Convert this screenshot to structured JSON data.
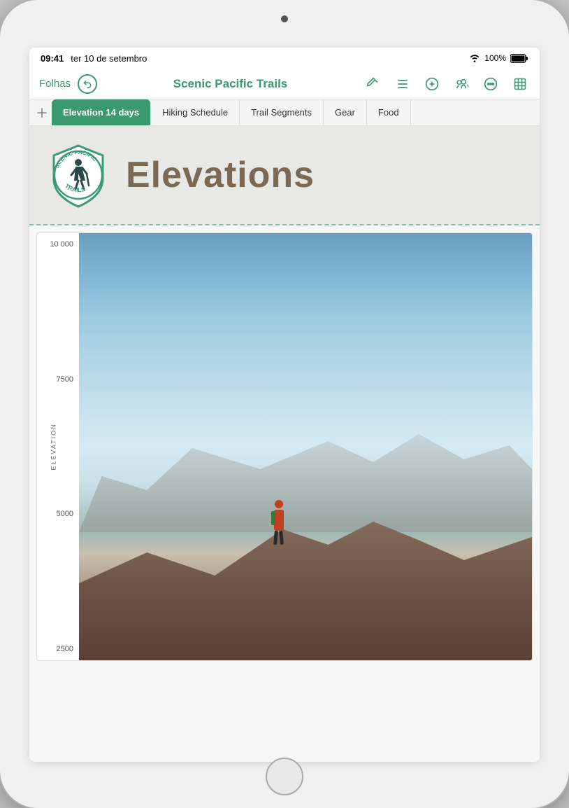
{
  "device": {
    "status_bar": {
      "time": "09:41",
      "date": "ter 10 de setembro",
      "battery_pct": "100%"
    }
  },
  "toolbar": {
    "back_label": "Folhas",
    "title": "Scenic Pacific Trails",
    "icons": [
      "pencil-pin-icon",
      "list-icon",
      "add-icon",
      "share-icon",
      "more-icon",
      "table-icon"
    ]
  },
  "tabs": [
    {
      "label": "Elevation 14 days",
      "active": true
    },
    {
      "label": "Hiking Schedule",
      "active": false
    },
    {
      "label": "Trail Segments",
      "active": false
    },
    {
      "label": "Gear",
      "active": false
    },
    {
      "label": "Food",
      "active": false
    }
  ],
  "sheet": {
    "logo_alt": "Scenic Pacific Trails badge",
    "title": "Elevations"
  },
  "chart": {
    "y_axis_label": "ELEVATION",
    "y_ticks": [
      "10 000",
      "7500",
      "5000",
      "2500"
    ],
    "image_alt": "Hiker standing on mountain ridge overlooking misty valley"
  },
  "colors": {
    "accent": "#3a9a6e",
    "tab_active_bg": "#3a9a6e",
    "tab_active_text": "#ffffff",
    "title_color": "#7a6a55",
    "logo_teal": "#3a9a7a"
  }
}
